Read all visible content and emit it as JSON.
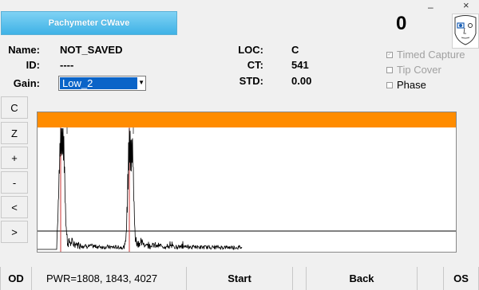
{
  "window": {
    "minimize_glyph": "–",
    "close_glyph": "×"
  },
  "header": {
    "title": "Pachymeter CWave",
    "counter": "0"
  },
  "info": {
    "name_label": "Name:",
    "name_value": "NOT_SAVED",
    "id_label": "ID:",
    "id_value": "----",
    "gain_label": "Gain:",
    "gain_value": "Low_2",
    "loc_label": "LOC:",
    "loc_value": "C",
    "ct_label": "CT:",
    "ct_value": "541",
    "std_label": "STD:",
    "std_value": "0.00"
  },
  "options": {
    "timed_capture": {
      "label": "Timed Capture",
      "checked": true,
      "enabled": false
    },
    "tip_cover": {
      "label": "Tip Cover",
      "checked": false,
      "enabled": false
    },
    "phase": {
      "label": "Phase",
      "checked": false,
      "enabled": true
    }
  },
  "side_buttons": [
    "C",
    "Z",
    "+",
    "-",
    "<",
    ">"
  ],
  "plot": {
    "band_color": "#ff8c00",
    "trace_color": "#000000",
    "marker_color": "#cc3333"
  },
  "bottom": {
    "eye_label": "OD",
    "pwr_text": "PWR=1808, 1843, 4027",
    "start_label": "Start",
    "back_label": "Back",
    "os_label": "OS"
  }
}
